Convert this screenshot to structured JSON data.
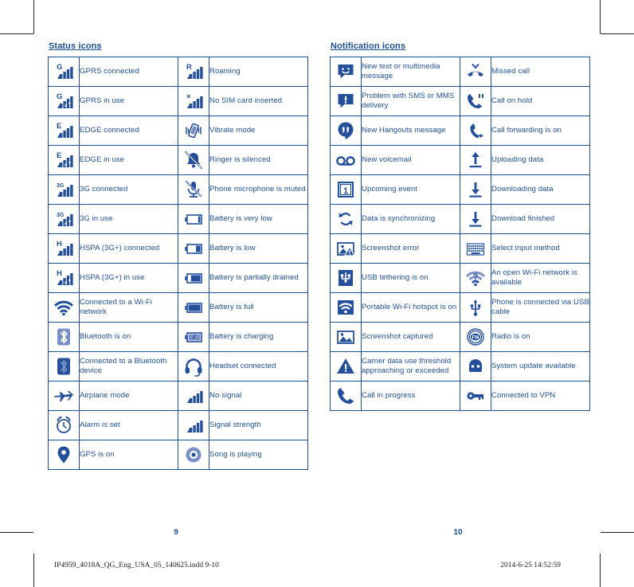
{
  "colors": {
    "brand_blue": "#1d4f99",
    "icon_blue": "#24509b",
    "icon_blue_light": "#7b8fc7",
    "crop_mark": "#231f20"
  },
  "left_column": {
    "title": "Status icons",
    "rows": [
      {
        "a": {
          "icon": "gprs-connected-icon",
          "label": "GPRS connected"
        },
        "b": {
          "icon": "roaming-icon",
          "label": "Roaming"
        }
      },
      {
        "a": {
          "icon": "gprs-in-use-icon",
          "label": "GPRS in use"
        },
        "b": {
          "icon": "no-sim-card-icon",
          "label": "No SIM card inserted"
        }
      },
      {
        "a": {
          "icon": "edge-connected-icon",
          "label": "EDGE connected"
        },
        "b": {
          "icon": "vibrate-mode-icon",
          "label": "Vibrate mode"
        }
      },
      {
        "a": {
          "icon": "edge-in-use-icon",
          "label": "EDGE in use"
        },
        "b": {
          "icon": "ringer-silenced-icon",
          "label": "Ringer is silenced"
        }
      },
      {
        "a": {
          "icon": "3g-connected-icon",
          "label": "3G connected"
        },
        "b": {
          "icon": "microphone-muted-icon",
          "label": "Phone microphone is muted"
        }
      },
      {
        "a": {
          "icon": "3g-in-use-icon",
          "label": "3G in use"
        },
        "b": {
          "icon": "battery-very-low-icon",
          "label": "Battery is very low"
        }
      },
      {
        "a": {
          "icon": "hspa-connected-icon",
          "label": "HSPA (3G+) connected"
        },
        "b": {
          "icon": "battery-low-icon",
          "label": "Battery is low"
        }
      },
      {
        "a": {
          "icon": "hspa-in-use-icon",
          "label": "HSPA (3G+) in use"
        },
        "b": {
          "icon": "battery-partially-drained-icon",
          "label": "Battery is partially drained"
        }
      },
      {
        "a": {
          "icon": "wifi-connected-icon",
          "label": "Connected to a Wi-Fi network"
        },
        "b": {
          "icon": "battery-full-icon",
          "label": "Battery is full"
        }
      },
      {
        "a": {
          "icon": "bluetooth-on-icon",
          "label": "Bluetooth is on"
        },
        "b": {
          "icon": "battery-charging-icon",
          "label": "Battery is charging"
        }
      },
      {
        "a": {
          "icon": "bluetooth-connected-icon",
          "label": "Connected to a Bluetooth device"
        },
        "b": {
          "icon": "headset-connected-icon",
          "label": "Headset connected"
        }
      },
      {
        "a": {
          "icon": "airplane-mode-icon",
          "label": "Airplane mode"
        },
        "b": {
          "icon": "no-signal-icon",
          "label": "No signal"
        }
      },
      {
        "a": {
          "icon": "alarm-set-icon",
          "label": "Alarm is set"
        },
        "b": {
          "icon": "signal-strength-icon",
          "label": "Signal strength"
        }
      },
      {
        "a": {
          "icon": "gps-on-icon",
          "label": "GPS is on"
        },
        "b": {
          "icon": "song-playing-icon",
          "label": "Song is playing"
        }
      }
    ]
  },
  "right_column": {
    "title": "Notification icons",
    "rows": [
      {
        "a": {
          "icon": "new-message-icon",
          "label": "New text or multimedia message"
        },
        "b": {
          "icon": "missed-call-icon",
          "label": "Missed call"
        }
      },
      {
        "a": {
          "icon": "message-problem-icon",
          "label": "Problem with SMS or MMS delivery"
        },
        "b": {
          "icon": "call-on-hold-icon",
          "label": "Call on hold"
        }
      },
      {
        "a": {
          "icon": "hangouts-message-icon",
          "label": "New Hangouts message"
        },
        "b": {
          "icon": "call-forwarding-icon",
          "label": "Call forwarding is on"
        }
      },
      {
        "a": {
          "icon": "voicemail-icon",
          "label": "New voicemail"
        },
        "b": {
          "icon": "uploading-data-icon",
          "label": "Uploading data"
        }
      },
      {
        "a": {
          "icon": "upcoming-event-icon",
          "label": "Upcoming event"
        },
        "b": {
          "icon": "downloading-data-icon",
          "label": "Downloading data"
        }
      },
      {
        "a": {
          "icon": "data-sync-icon",
          "label": "Data is synchronizing"
        },
        "b": {
          "icon": "download-finished-icon",
          "label": "Download finished"
        }
      },
      {
        "a": {
          "icon": "screenshot-error-icon",
          "label": "Screenshot error"
        },
        "b": {
          "icon": "select-input-method-icon",
          "label": "Select input method"
        }
      },
      {
        "a": {
          "icon": "usb-tethering-icon",
          "label": "USB tethering is on"
        },
        "b": {
          "icon": "open-wifi-available-icon",
          "label": "An open Wi-Fi network is available"
        }
      },
      {
        "a": {
          "icon": "wifi-hotspot-icon",
          "label": "Portable Wi-Fi hotspot is on"
        },
        "b": {
          "icon": "usb-connected-icon",
          "label": "Phone is connected via USB cable"
        }
      },
      {
        "a": {
          "icon": "screenshot-captured-icon",
          "label": "Screenshot captured"
        },
        "b": {
          "icon": "radio-on-icon",
          "label": "Radio is on"
        }
      },
      {
        "a": {
          "icon": "carrier-data-warning-icon",
          "label": "Carrier data use threshold approaching or exceeded"
        },
        "b": {
          "icon": "system-update-icon",
          "label": "System update available"
        }
      },
      {
        "a": {
          "icon": "call-in-progress-icon",
          "label": "Call in progress"
        },
        "b": {
          "icon": "vpn-connected-icon",
          "label": "Connected to VPN"
        }
      }
    ]
  },
  "footer": {
    "page_left": "9",
    "page_right": "10",
    "imprint_file": "IP4959_4018A_QG_Eng_USA_05_140625.indd  9-10",
    "imprint_date": "2014-6-25  14:52:59"
  }
}
